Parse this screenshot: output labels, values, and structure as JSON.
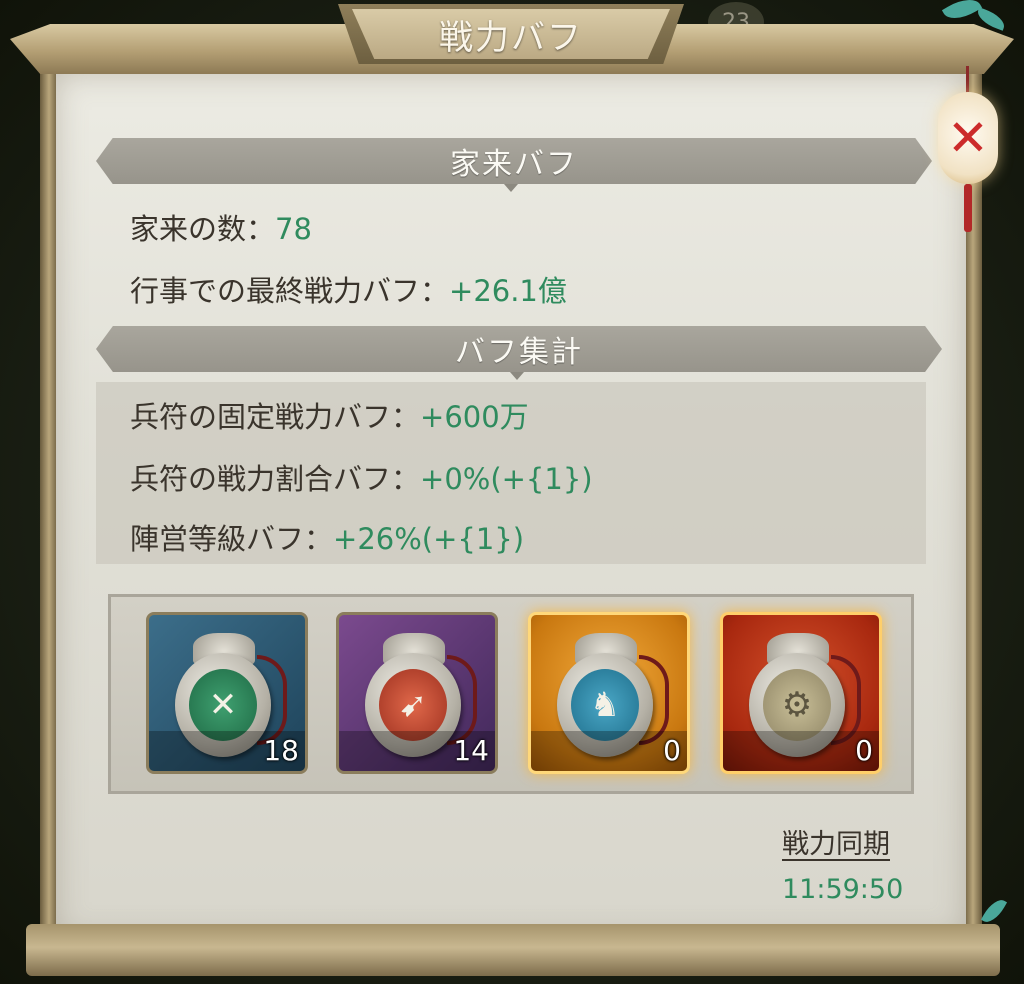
{
  "window": {
    "title": "戦力バフ",
    "top_badge": "23"
  },
  "vassal_section": {
    "header": "家来バフ",
    "count_label": "家来の数：",
    "count_value": "78",
    "final_buff_label": "行事での最終戦力バフ：",
    "final_buff_value": "+26.1億"
  },
  "summary_section": {
    "header": "バフ集計",
    "rows": [
      {
        "label": "兵符の固定戦力バフ：",
        "value": "+600万"
      },
      {
        "label": "兵符の戦力割合バフ：",
        "value": "+0%(+{1})"
      },
      {
        "label": "陣営等級バフ：",
        "value": "+26%(+{1})"
      }
    ]
  },
  "tallies": [
    {
      "name": "blue-tally",
      "count": "18",
      "frame_color": "#3c6e8a",
      "emblem": "sword-icon",
      "glyph": "✕"
    },
    {
      "name": "purple-tally",
      "count": "14",
      "frame_color": "#7b4a8e",
      "emblem": "bow-icon",
      "glyph": "➹"
    },
    {
      "name": "gold-tally",
      "count": "0",
      "frame_color": "#e39a2a",
      "emblem": "horse-icon",
      "glyph": "♞"
    },
    {
      "name": "red-tally",
      "count": "0",
      "frame_color": "#b83a1a",
      "emblem": "chariot-icon",
      "glyph": "⚙"
    }
  ],
  "sync": {
    "label": "戦力同期",
    "timer": "11:59:50"
  },
  "colors": {
    "value_green": "#2f8b5e",
    "text_dark": "#3a342c",
    "close_red": "#cc2b2b"
  },
  "close_button": {
    "icon": "close-icon",
    "glyph": "✕"
  }
}
